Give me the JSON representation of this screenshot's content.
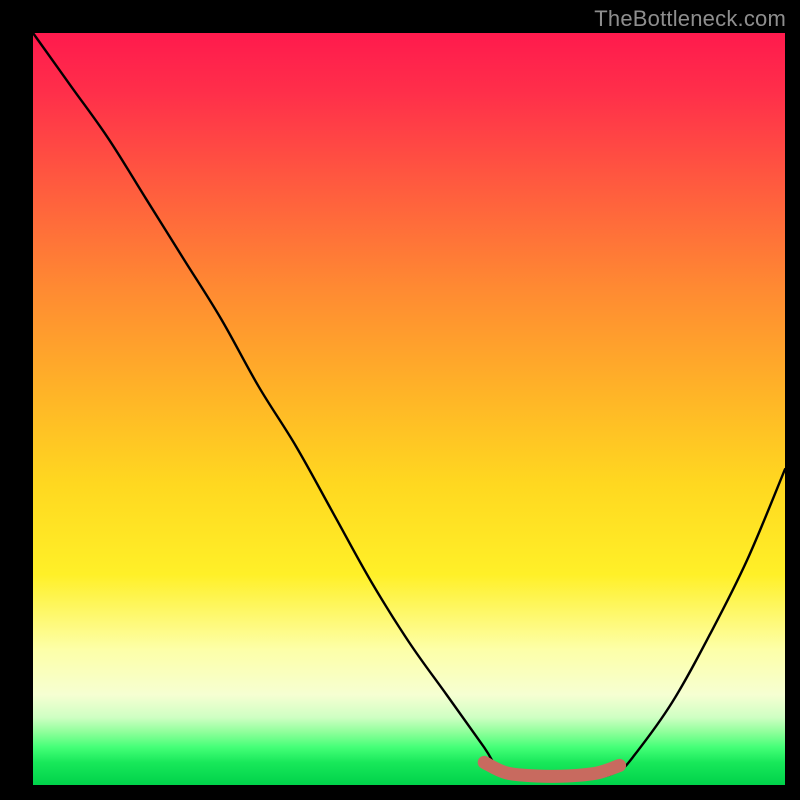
{
  "watermark": "TheBottleneck.com",
  "colors": {
    "frame": "#000000",
    "curve": "#000000",
    "accent_segment": "#c86a5f",
    "gradient_top": "#ff1a4d",
    "gradient_bottom": "#00d24a"
  },
  "chart_data": {
    "type": "line",
    "title": "",
    "xlabel": "",
    "ylabel": "",
    "xlim": [
      0,
      100
    ],
    "ylim": [
      0,
      100
    ],
    "grid": false,
    "legend": false,
    "note": "No axes, ticks, or numeric labels are rendered. Values below are estimates read from curve position relative to plot area (y=0 at bottom edge / green band, y=100 at top edge / red).",
    "series": [
      {
        "name": "bottleneck-curve",
        "x": [
          0,
          5,
          10,
          15,
          20,
          25,
          30,
          35,
          40,
          45,
          50,
          55,
          60,
          62,
          65,
          70,
          75,
          78,
          80,
          85,
          90,
          95,
          100
        ],
        "y": [
          100,
          93,
          86,
          78,
          70,
          62,
          53,
          45,
          36,
          27,
          19,
          12,
          5,
          2,
          1,
          1,
          1,
          2,
          4,
          11,
          20,
          30,
          42
        ]
      }
    ],
    "accent_segment": {
      "name": "optimal-range-marker",
      "color": "#c86a5f",
      "x": [
        60,
        63,
        67,
        71,
        75,
        78
      ],
      "y": [
        3.0,
        1.6,
        1.2,
        1.2,
        1.6,
        2.6
      ]
    }
  }
}
